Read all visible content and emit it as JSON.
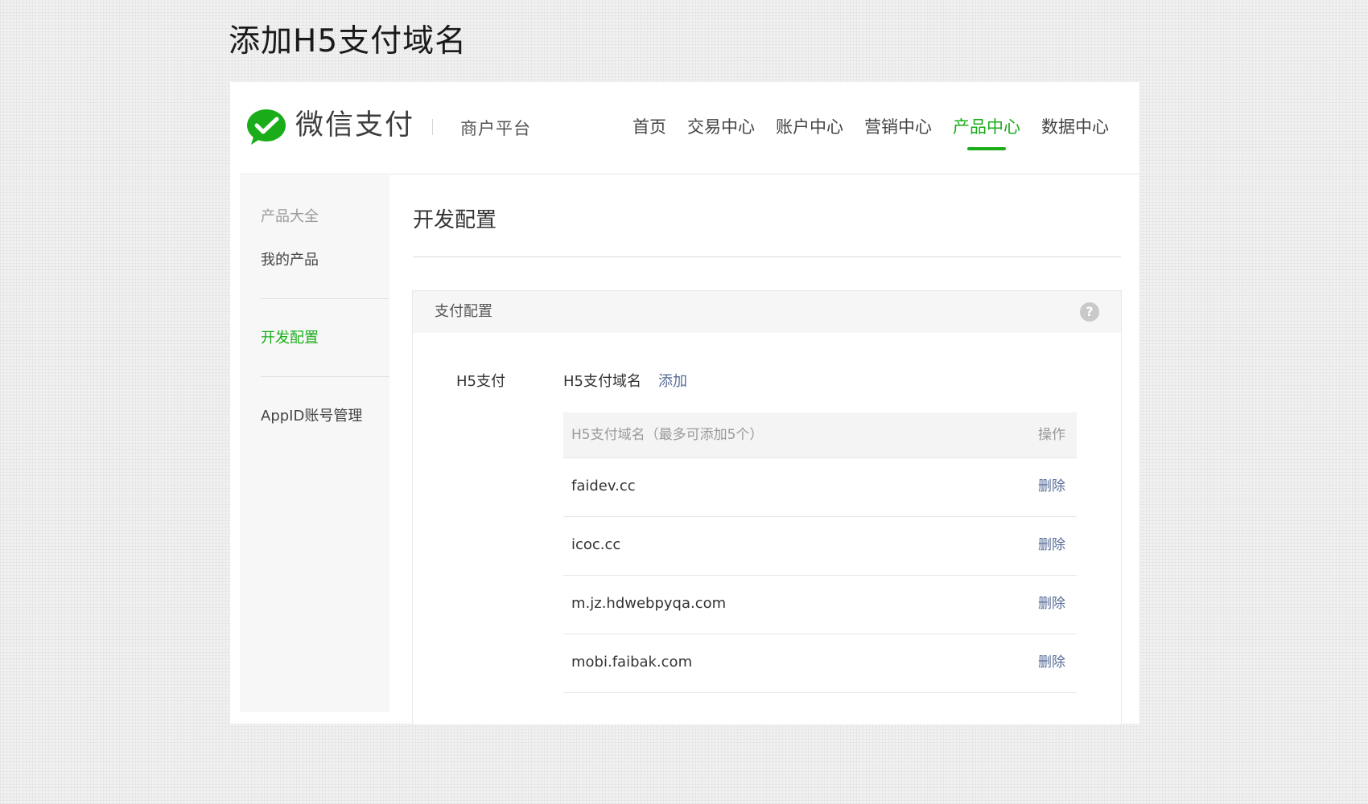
{
  "heading": "添加H5支付域名",
  "header": {
    "brand": "微信支付",
    "platform": "商户平台",
    "nav": [
      "首页",
      "交易中心",
      "账户中心",
      "营销中心",
      "产品中心",
      "数据中心"
    ],
    "active_nav": "产品中心",
    "accent_color": "#1aad19"
  },
  "sidebar": {
    "items": [
      "产品大全",
      "我的产品",
      "开发配置",
      "AppID账号管理"
    ],
    "active": "开发配置"
  },
  "main": {
    "title": "开发配置",
    "panel_title": "支付配置",
    "help_icon": "?",
    "tab_label": "H5支付",
    "domain_label": "H5支付域名",
    "add_link": "添加",
    "table": {
      "col_name": "H5支付域名（最多可添加5个）",
      "col_op": "操作",
      "rows": [
        {
          "domain": "faidev.cc",
          "action": "删除"
        },
        {
          "domain": "icoc.cc",
          "action": "删除"
        },
        {
          "domain": "m.jz.hdwebpyqa.com",
          "action": "删除"
        },
        {
          "domain": "mobi.faibak.com",
          "action": "删除"
        }
      ]
    }
  }
}
